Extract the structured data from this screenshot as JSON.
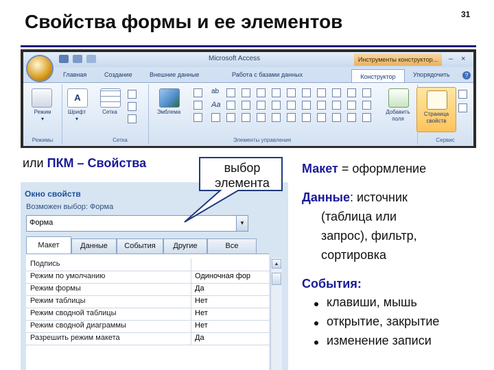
{
  "slide": {
    "title": "Свойства формы и ее элементов",
    "page_number": "31"
  },
  "ribbon": {
    "app_title": "Microsoft Access",
    "context_tools": "Инструменты конструктор...",
    "tabs": [
      "Главная",
      "Создание",
      "Внешние данные",
      "Работа с базами данных",
      "Конструктор",
      "Упорядочить"
    ],
    "active_tab": "Конструктор",
    "buttons": {
      "mode": "Режим",
      "font": "Шрифт",
      "grid": "Сетка",
      "emblem": "Эмблема",
      "add_fields": [
        "Добавить",
        "поля"
      ],
      "property_sheet": [
        "Страница",
        "свойств"
      ]
    },
    "group_labels": {
      "modes": "Режимы",
      "grid": "Сетка",
      "controls": "Элементы управления",
      "service": "Сервис"
    }
  },
  "caption": {
    "prefix": "или ",
    "strong": "ПКМ – Свойства"
  },
  "callout": {
    "line1": "выбор",
    "line2": "элемента"
  },
  "property_sheet": {
    "title": "Окно свойств",
    "selection_label": "Возможен выбор:  Форма",
    "combo_value": "Форма",
    "tabs": [
      "Макет",
      "Данные",
      "События",
      "Другие",
      "Все"
    ],
    "active_tab": "Макет",
    "rows": [
      {
        "name": "Подпись",
        "value": ""
      },
      {
        "name": "Режим по умолчанию",
        "value": "Одиночная фор"
      },
      {
        "name": "Режим формы",
        "value": "Да"
      },
      {
        "name": "Режим таблицы",
        "value": "Нет"
      },
      {
        "name": "Режим сводной таблицы",
        "value": "Нет"
      },
      {
        "name": "Режим сводной диаграммы",
        "value": "Нет"
      },
      {
        "name": "Разрешить режим макета",
        "value": "Да"
      }
    ]
  },
  "right_text": {
    "layout_kw": "Макет",
    "layout_rest": " = оформление",
    "data_kw": "Данные",
    "data_lines": [
      ": источник",
      "(таблица или",
      "запрос), фильтр,",
      "сортировка"
    ],
    "events_kw": "События:",
    "bullets": [
      "клавиши, мышь",
      "открытие, закрытие",
      "изменение записи"
    ]
  },
  "colors": {
    "accent_text": "#1a1a9a",
    "title_rule": "#1a1a7a",
    "active_tool_highlight": "#ffc45a"
  }
}
